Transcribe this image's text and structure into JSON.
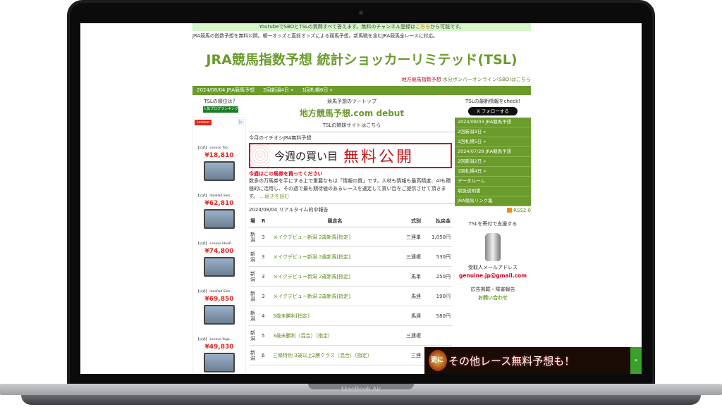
{
  "device": {
    "brand_label": "MacBook Air"
  },
  "site": {
    "notice_pre": "YoutubeでSBOとTSLの質問すべて答えます。無料のチャンネル登録は",
    "notice_link": "こちら",
    "notice_post": "から可能です。",
    "intro": "JRA競馬の指数予想を無料公開。朝一オッズと直前オッズによる競馬予想。新馬戦を含むJRA競馬全レースに対応。",
    "title": "JRA競馬指数予想 統計ショッカーリミテッド(TSL)",
    "sublink_red": "地方競馬指数予想",
    "sublink_green": "水分ボンバーオンライン(SBO)はこちら",
    "menu": [
      "2024/08/04 JRA競馬予想",
      "2回新潟4日 »",
      "1回札幌6日 »"
    ]
  },
  "left": {
    "rank_label": "TSLの順位は？",
    "badge": "人気ブログランキング",
    "ad_brand": "Lenovo",
    "ad_chip": "▷",
    "products": [
      {
        "name": "【公式】 Lenovo Tab...",
        "price": "¥18,810"
      },
      {
        "name": "【公式】 IdeaPad Slim...",
        "price": "¥62,810"
      },
      {
        "name": "【公式】 Lenovo IdeaP...",
        "price": "¥74,800"
      },
      {
        "name": "【公式】 IdeaPad Slim...",
        "price": "¥69,850"
      },
      {
        "name": "【公式】 Lenovo Yoga...",
        "price": "¥49,830"
      }
    ]
  },
  "center": {
    "tool_top": "競馬予想のツートップ",
    "tool_title": "地方競馬予想.com debut",
    "tool_sub": "TSLの姉妹サイトはこちら",
    "pick_heading": "今月のイチオシJRA無料予想",
    "banner_text1": "今週の買い目",
    "banner_text2": "無料公開",
    "pick_red": "今週はこの馬券を買ってください",
    "pick_body": "数多の万馬券を手にする上で重要なもは「情報の質」です。人材も情報も最高精度、AIも積極的に活用し、その週で最も期待値のあるレースを選定して買い目をご提供させて頂きます。",
    "pick_more": "…続きを読む",
    "result_heading": "2024/08/04 リアルタイム的中報告",
    "table_headers": [
      "場",
      "R",
      "競走名",
      "式別",
      "払戻金"
    ],
    "rows": [
      {
        "venue": "新潟",
        "r": "3",
        "race": "メイクデビュー新潟 2歳新馬[指定]",
        "bet": "三連単",
        "pay": "1,050円"
      },
      {
        "venue": "新潟",
        "r": "3",
        "race": "メイクデビュー新潟 2歳新馬[指定]",
        "bet": "三連複",
        "pay": "530円"
      },
      {
        "venue": "新潟",
        "r": "3",
        "race": "メイクデビュー新潟 2歳新馬[指定]",
        "bet": "馬単",
        "pay": "250円"
      },
      {
        "venue": "新潟",
        "r": "3",
        "race": "メイクデビュー新潟 2歳新馬[指定]",
        "bet": "馬連",
        "pay": "190円"
      },
      {
        "venue": "新潟",
        "r": "4",
        "race": "3歳未勝利[指定]",
        "bet": "馬連",
        "pay": "580円"
      },
      {
        "venue": "新潟",
        "r": "5",
        "race": "3歳未勝利（混合）〔指定〕",
        "bet": "三連複",
        "pay": ""
      },
      {
        "venue": "新潟",
        "r": "6",
        "race": "三條特別 3歳以上2勝クラス（混合）〔指定〕",
        "bet": "三連",
        "pay": ""
      }
    ]
  },
  "right": {
    "latest": "TSLの最新情報をcheck!",
    "follow": "X フォローする",
    "items": [
      "2024/08/03 JRA競馬予想",
      "2回新潟3日 »",
      "1回札幌5日 »",
      "2024/07/28 JRA競馬予想",
      "2回新潟2日 »",
      "1回札幌4日 »",
      "データルーム",
      "取扱説明書",
      "JRA競馬リンク集"
    ],
    "rss": "RSS2.0",
    "donate": "TSLを寄付で支援する",
    "email_label": "受取人メールアドレス",
    "email": "genuine.jp@gmail.com",
    "report": "広告掲載・障害報告",
    "contact": "お問い合わせ"
  },
  "float_banner": {
    "text": "その他レース無料予想も！",
    "mark": "更に",
    "arrow": "»"
  }
}
